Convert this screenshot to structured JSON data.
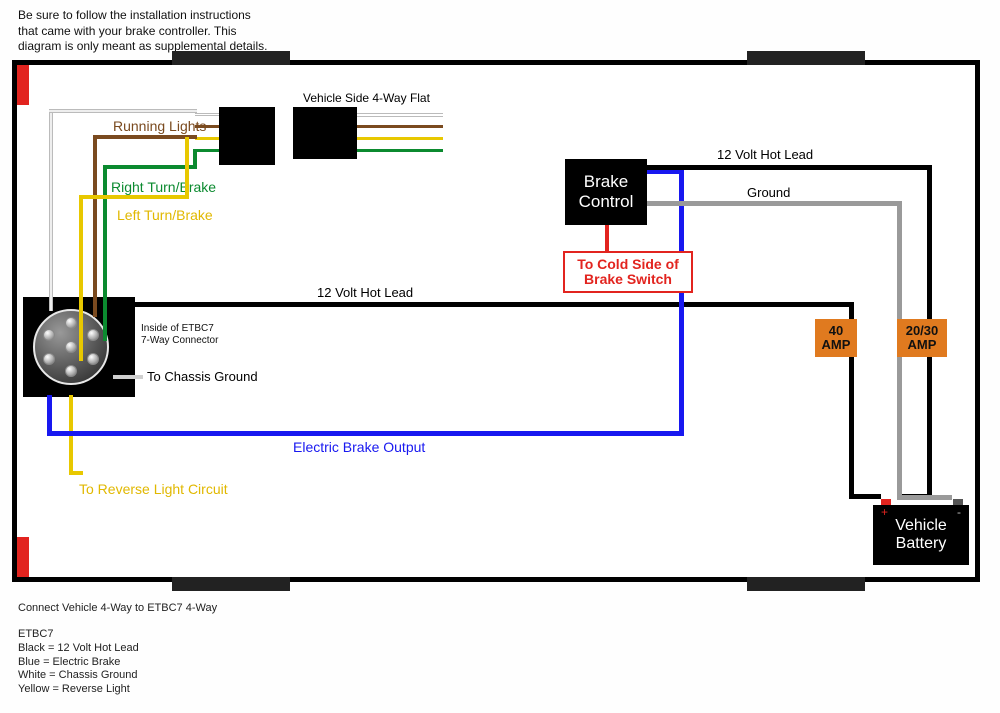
{
  "instructions": {
    "l1": "Be sure to follow the installation instructions",
    "l2": "that came with your brake controller. This",
    "l3": "diagram is only meant as supplemental details."
  },
  "labels": {
    "vehicle_side_4way": "Vehicle Side 4-Way Flat",
    "running_lights": "Running Lights",
    "right_turn_brake": "Right Turn/Brake",
    "left_turn_brake": "Left Turn/Brake",
    "inside_connector_l1": "Inside of ETBC7",
    "inside_connector_l2": "7-Way Connector",
    "to_chassis_ground": "To Chassis Ground",
    "to_reverse_light": "To Reverse Light Circuit",
    "electric_brake_output": "Electric Brake Output",
    "hot_lead_top": "12 Volt Hot Lead",
    "hot_lead_left": "12 Volt Hot Lead",
    "ground": "Ground",
    "cold_side_l1": "To Cold Side of",
    "cold_side_l2": "Brake Switch"
  },
  "boxes": {
    "brake_control": "Brake\nControl",
    "amp40": "40\nAMP",
    "amp2030": "20/30\nAMP",
    "battery": "Vehicle\nBattery"
  },
  "battery_terminals": {
    "pos": "+",
    "neg": "-"
  },
  "footer": {
    "connect": "Connect Vehicle 4-Way to ETBC7 4-Way",
    "legend_title": "ETBC7",
    "legend_black": "Black = 12 Volt Hot Lead",
    "legend_blue": "Blue = Electric Brake",
    "legend_white": "White = Chassis Ground",
    "legend_yellow": "Yellow = Reverse Light"
  },
  "colors": {
    "brown": "#7a4a1f",
    "green": "#0b8a2f",
    "yellow": "#e8c800",
    "blue": "#1818f0",
    "red": "#e2241f",
    "gray": "#9a9a9a",
    "black": "#000",
    "white": "#fff",
    "orange": "#e07a1f"
  }
}
